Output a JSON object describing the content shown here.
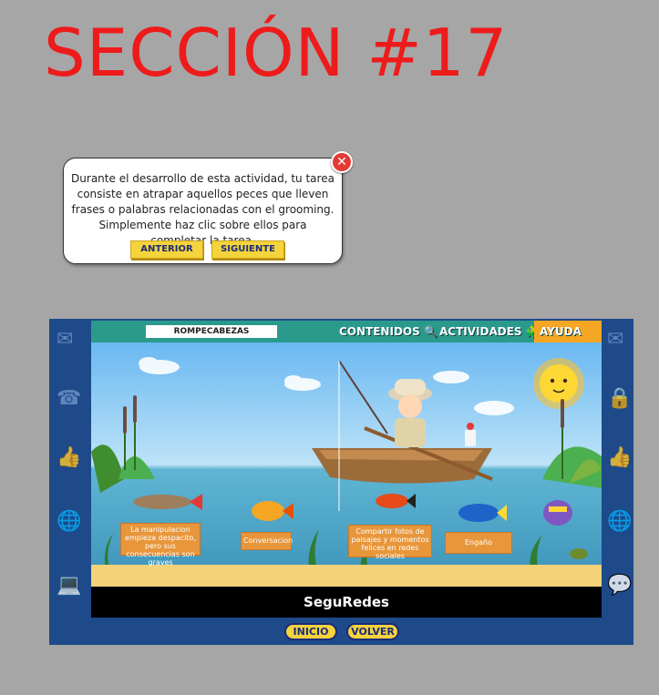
{
  "page": {
    "title": "SECCIÓN #17"
  },
  "tooltip": {
    "text": "Durante el desarrollo de esta actividad, tu tarea consiste en atrapar aquellos peces que lleven frases o palabras relacionadas con el grooming. Simplemente haz clic sobre ellos para completar la tarea.",
    "prev_label": "ANTERIOR",
    "next_label": "SIGUIENTE",
    "close_symbol": "✕"
  },
  "app": {
    "puzzle_label": "ROMPECABEZAS",
    "nav": {
      "contenidos": "CONTENIDOS",
      "actividades": "ACTIVIDADES",
      "ayuda": "AYUDA"
    },
    "fish_labels": [
      "La manipulacion empieza despacito, pero sus consecuencias son graves",
      "Conversacion",
      "Compartir fotos de paisajes y momentos felices en redes sociales",
      "Engaño"
    ],
    "brand": "SeguRedes",
    "buttons": {
      "inicio": "INICIO",
      "volver": "VOLVER"
    }
  },
  "colors": {
    "title": "#ee1b1b",
    "background": "#a6a6a6",
    "button_yellow": "#f5d33c",
    "frame_blue": "#1e4a8a",
    "topbar_teal": "#2a9a8c",
    "label_orange": "#e8963a"
  }
}
